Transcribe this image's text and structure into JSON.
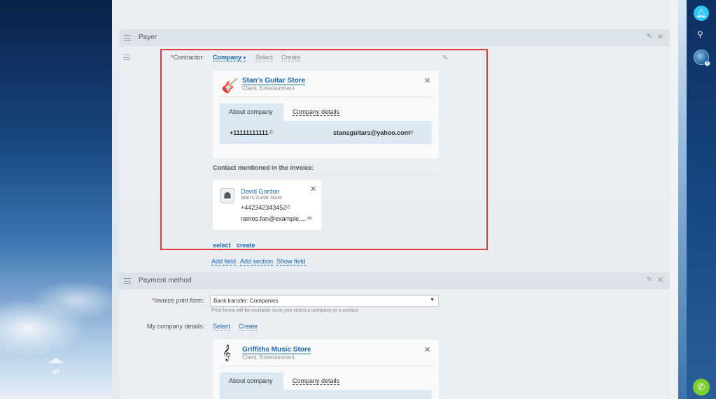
{
  "nav": {
    "up_label": "UP"
  },
  "payer_section": {
    "title": "Payer",
    "contractor_label": "*Contractor:",
    "type_dropdown": "Company",
    "select_link": "Select",
    "create_link": "Create",
    "company_card": {
      "name": "Stan's Guitar Store",
      "subtitle": "Client, Entertainment",
      "tab_about": "About company",
      "tab_details": "Company details",
      "phone": "+11111111111",
      "email": "stansguitars@yahoo.com"
    },
    "contact_heading": "Contact mentioned in the invoice:",
    "contact_card": {
      "name": "David Gordon",
      "company": "Stan's Guitar Store",
      "phone": "+442342343452",
      "email": "ramos.fan@example...."
    },
    "contact_select": "select",
    "contact_create": "create",
    "add_field": "Add field",
    "add_section": "Add section",
    "show_field": "Show field"
  },
  "payment_section": {
    "title": "Payment method",
    "print_form_label": "*Invoice print form:",
    "print_form_value": "Bank transfer: Companies",
    "print_form_hint": "Print forms will be available once you select a company or a contact",
    "my_company_label": "My company details:",
    "select_link": "Select",
    "create_link": "Create",
    "company_card": {
      "name": "Griffiths Music Store",
      "subtitle": "Client, Entertainment",
      "tab_about": "About company",
      "tab_details": "Company details"
    }
  },
  "icons": {
    "bell": "bell-icon",
    "search": "search-icon",
    "phone": "phone-icon",
    "edit": "pencil-icon",
    "close": "close-icon",
    "guitar": "guitar-icon",
    "treble_clef": "treble-clef-icon",
    "contact": "contact-card-icon",
    "mail": "mail-icon"
  },
  "colors": {
    "link": "#2067b0",
    "highlight_border": "#e0393e",
    "required": "#e0303a",
    "bell": "#2fc6f6",
    "phone": "#7ccf2e"
  }
}
